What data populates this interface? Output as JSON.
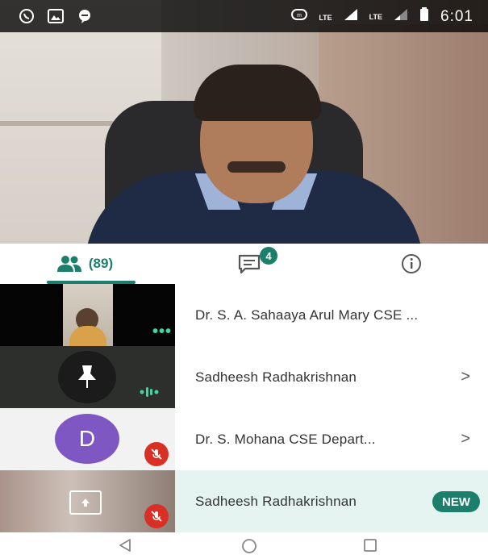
{
  "status_bar": {
    "time": "6:01",
    "network_1": "LTE",
    "network_2": "LTE",
    "volte": "LTE",
    "left_icons": [
      "whatsapp-icon",
      "gallery-icon",
      "chat-bubble-icon"
    ],
    "right_icons": [
      "nfc-icon",
      "volte-call-icon",
      "signal-icon",
      "signal-icon",
      "battery-icon"
    ]
  },
  "tabs": {
    "people_count": "(89)",
    "chat_badge": "4",
    "icons": [
      "people-icon",
      "chat-icon",
      "info-icon"
    ],
    "accent": "#1b7f6b"
  },
  "participants": [
    {
      "name": "Dr. S. A. Sahaaya Arul Mary CSE ...",
      "thumb": "video",
      "status_icon": "more-dots-icon"
    },
    {
      "name": "Sadheesh Radhakrishnan",
      "thumb": "phone-pin",
      "status_icon": "speaking-icon",
      "chevron": ">"
    },
    {
      "name": "Dr. S. Mohana CSE Depart...",
      "avatar_letter": "D",
      "status_icon": "mic-off-icon",
      "chevron": ">",
      "avatar_color": "#7e57c2"
    },
    {
      "name": "Sadheesh Radhakrishnan",
      "thumb": "screen-share",
      "status_icon": "mic-off-icon",
      "badge": "NEW"
    }
  ],
  "nav_bar": {
    "icons": [
      "back-icon",
      "home-icon",
      "recents-icon"
    ]
  }
}
